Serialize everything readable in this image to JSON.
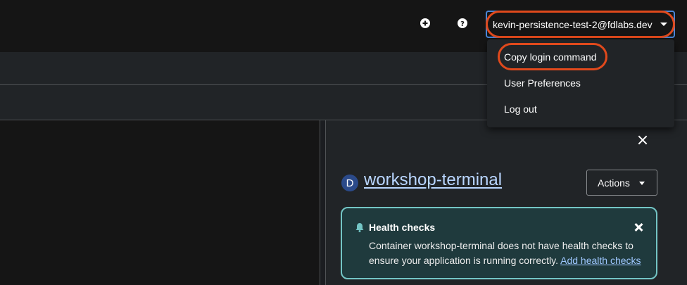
{
  "masthead": {
    "icons": [
      "plus-circle-icon",
      "question-circle-icon"
    ],
    "user": {
      "label": "kevin-persistence-test-2@fdlabs.dev"
    }
  },
  "user_menu": {
    "items": [
      {
        "label": "Copy login command"
      },
      {
        "label": "User Preferences"
      },
      {
        "label": "Log out"
      }
    ]
  },
  "side_panel": {
    "badge": "D",
    "title": "workshop-terminal",
    "actions_label": "Actions",
    "alert": {
      "title": "Health checks",
      "message": "Container workshop-terminal does not have health checks to ensure your application is running correctly.",
      "link_label": "Add health checks"
    }
  },
  "colors": {
    "background": "#151515",
    "panel": "#212427",
    "highlight": "#e0491c",
    "alert_border": "#73c5c5",
    "link": "#b9d6ff"
  }
}
